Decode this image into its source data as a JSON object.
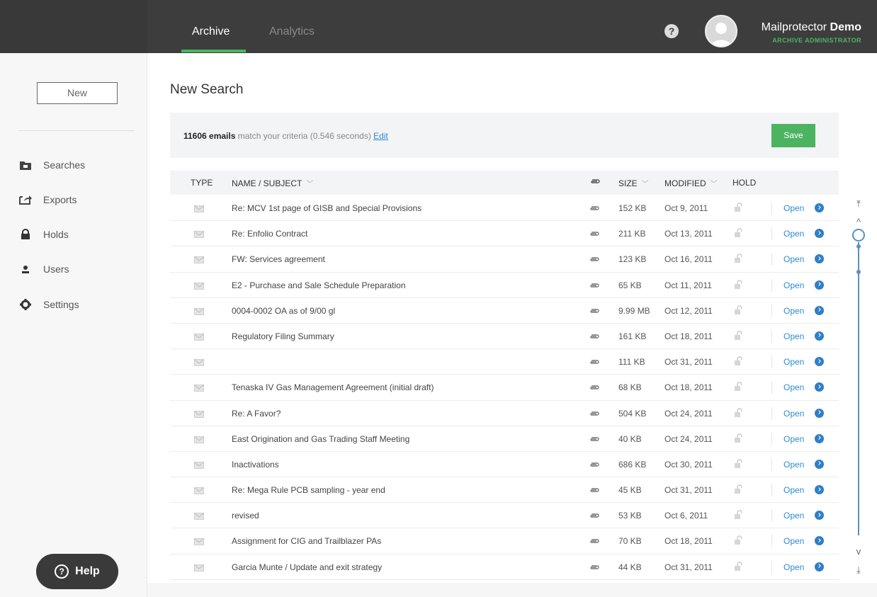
{
  "header": {
    "tabs": [
      {
        "label": "Archive",
        "active": true
      },
      {
        "label": "Analytics",
        "active": false
      }
    ],
    "help_glyph": "?",
    "user": {
      "name_regular": "Mailprotector ",
      "name_bold": "Demo",
      "role": "ARCHIVE ADMINISTRATOR"
    }
  },
  "sidebar": {
    "new_label": "New",
    "items": [
      {
        "label": "Searches",
        "icon": "folder-icon"
      },
      {
        "label": "Exports",
        "icon": "export-icon"
      },
      {
        "label": "Holds",
        "icon": "lock-icon"
      },
      {
        "label": "Users",
        "icon": "user-icon"
      },
      {
        "label": "Settings",
        "icon": "gear-icon"
      }
    ],
    "help_label": "Help"
  },
  "main": {
    "title": "New Search",
    "summary": {
      "count": "11606 emails",
      "text": " match your criteria (0.546 seconds) ",
      "edit": "Edit"
    },
    "save_label": "Save",
    "columns": {
      "type": "TYPE",
      "name": "NAME / SUBJECT",
      "size": "SIZE",
      "modified": "MODIFIED",
      "hold": "HOLD"
    },
    "open_label": "Open",
    "rows": [
      {
        "subject": "Re: MCV 1st page of GISB and Special Provisions",
        "size": "152 KB",
        "modified": "Oct 9, 2011"
      },
      {
        "subject": "Re: Enfolio Contract",
        "size": "211 KB",
        "modified": "Oct 13, 2011"
      },
      {
        "subject": "FW: Services agreement",
        "size": "123 KB",
        "modified": "Oct 16, 2011"
      },
      {
        "subject": "E2 - Purchase and Sale Schedule Preparation",
        "size": "65 KB",
        "modified": "Oct 11, 2011"
      },
      {
        "subject": "0004-0002 OA as of 9/00 gl",
        "size": "9.99 MB",
        "modified": "Oct 12, 2011"
      },
      {
        "subject": "Regulatory Filing Summary",
        "size": "161 KB",
        "modified": "Oct 18, 2011"
      },
      {
        "subject": "",
        "size": "111 KB",
        "modified": "Oct 31, 2011"
      },
      {
        "subject": "Tenaska IV Gas Management Agreement (initial draft)",
        "size": "68 KB",
        "modified": "Oct 18, 2011"
      },
      {
        "subject": "Re: A Favor?",
        "size": "504 KB",
        "modified": "Oct 24, 2011"
      },
      {
        "subject": "East Origination and Gas Trading Staff Meeting",
        "size": "40 KB",
        "modified": "Oct 24, 2011"
      },
      {
        "subject": "Inactivations",
        "size": "686 KB",
        "modified": "Oct 30, 2011"
      },
      {
        "subject": "Re: Mega Rule PCB sampling - year end",
        "size": "45 KB",
        "modified": "Oct 31, 2011"
      },
      {
        "subject": "revised",
        "size": "53 KB",
        "modified": "Oct 6, 2011"
      },
      {
        "subject": "Assignment for CIG and Trailblazer PAs",
        "size": "70 KB",
        "modified": "Oct 18, 2011"
      },
      {
        "subject": "Garcia Munte / Update and exit strategy",
        "size": "44 KB",
        "modified": "Oct 31, 2011"
      }
    ]
  },
  "scroller": {
    "top": "⤒",
    "up": "^",
    "down": "v",
    "bottom": "⤓"
  }
}
